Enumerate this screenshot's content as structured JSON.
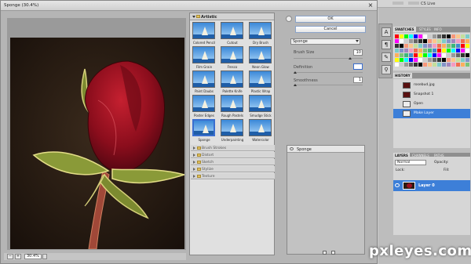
{
  "window": {
    "title": "Sponge (30.4%)"
  },
  "photoshop": {
    "cs_live": "CS Live"
  },
  "preview": {
    "zoom": "30.4%"
  },
  "gallery": {
    "category": "Artistic",
    "filters": [
      {
        "label": "Colored Pencil"
      },
      {
        "label": "Cutout"
      },
      {
        "label": "Dry Brush"
      },
      {
        "label": "Film Grain"
      },
      {
        "label": "Fresco"
      },
      {
        "label": "Neon Glow"
      },
      {
        "label": "Paint Daubs"
      },
      {
        "label": "Palette Knife"
      },
      {
        "label": "Plastic Wrap"
      },
      {
        "label": "Poster Edges"
      },
      {
        "label": "Rough Pastels"
      },
      {
        "label": "Smudge Stick"
      },
      {
        "label": "Sponge"
      },
      {
        "label": "Underpainting"
      },
      {
        "label": "Watercolor"
      }
    ],
    "selected": "Sponge",
    "categories": [
      "Brush Strokes",
      "Distort",
      "Sketch",
      "Stylize",
      "Texture"
    ]
  },
  "options": {
    "ok_label": "OK",
    "cancel_label": "Cancel",
    "filter_select": "Sponge",
    "brush_size_label": "Brush Size",
    "brush_size": "10",
    "definition_label": "Definition",
    "definition": "",
    "smoothness_label": "Smoothness",
    "smoothness": "1"
  },
  "effect_layers": {
    "layer_name": "Sponge"
  },
  "swatch_tabs": [
    "SWATCHES",
    "STYLES",
    "INFO"
  ],
  "history": {
    "tab": "HISTORY",
    "items": [
      {
        "label": "rosebud.jpg"
      },
      {
        "label": "Snapshot 1"
      },
      {
        "label": "Open"
      },
      {
        "label": "Make Layer"
      }
    ]
  },
  "layers": {
    "tabs": [
      "LAYERS",
      "CHANNELS",
      "PATHS"
    ],
    "blend_mode": "Normal",
    "opacity_label": "Opacity:",
    "lock_label": "Lock:",
    "fill_label": "Fill:",
    "layer_name": "Layer 0"
  },
  "watermark": "pxleyes.com",
  "colors": {
    "selection_blue": "#3d7fd8",
    "dialog_gray": "#b5b5b5",
    "rose_red": "#9b1020"
  }
}
